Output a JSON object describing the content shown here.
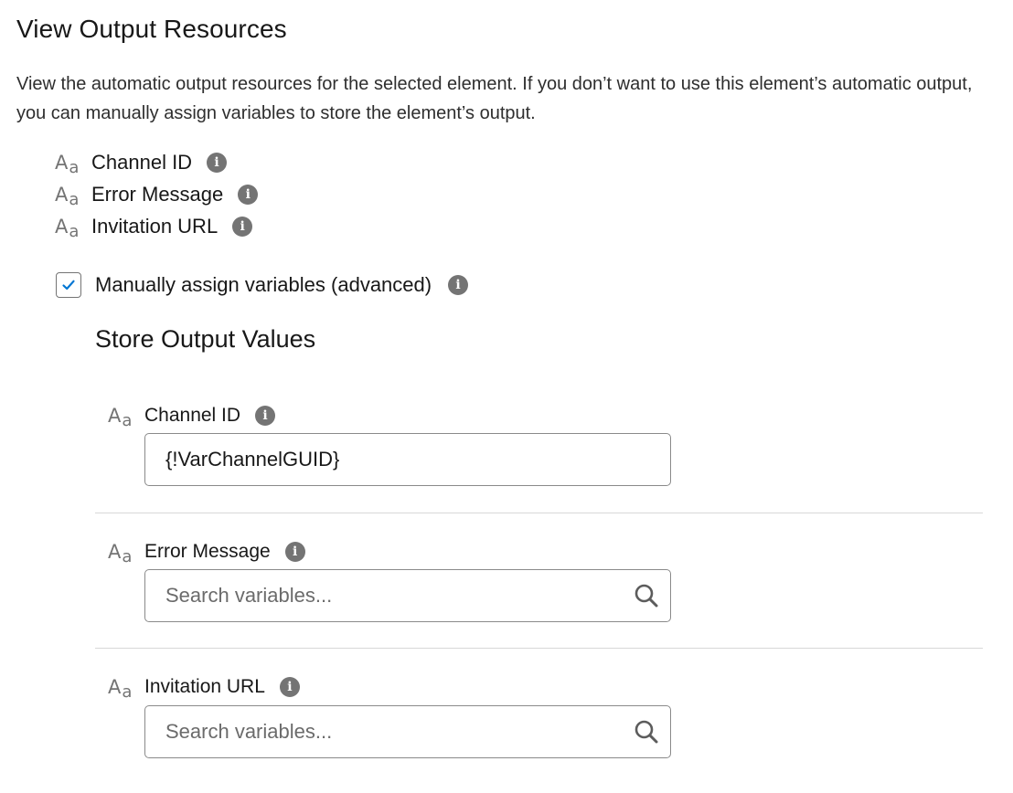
{
  "page": {
    "title": "View Output Resources",
    "description": "View the automatic output resources for the selected element. If you don’t want to use this element’s automatic output, you can manually assign variables to store the element’s output."
  },
  "resources": [
    {
      "icon": "text-type-icon",
      "glyph_big": "A",
      "glyph_small": "a",
      "label": "Channel ID",
      "info_glyph": "i"
    },
    {
      "icon": "text-type-icon",
      "glyph_big": "A",
      "glyph_small": "a",
      "label": "Error Message",
      "info_glyph": "i"
    },
    {
      "icon": "text-type-icon",
      "glyph_big": "A",
      "glyph_small": "a",
      "label": "Invitation URL",
      "info_glyph": "i"
    }
  ],
  "manual_assign": {
    "label": "Manually assign variables (advanced)",
    "checked": true,
    "info_glyph": "i"
  },
  "store_output": {
    "title": "Store Output Values",
    "fields": [
      {
        "label": "Channel ID",
        "value": "{!VarChannelGUID}",
        "placeholder": ""
      },
      {
        "label": "Error Message",
        "value": "",
        "placeholder": "Search variables..."
      },
      {
        "label": "Invitation URL",
        "value": "",
        "placeholder": "Search variables..."
      }
    ]
  },
  "colors": {
    "icon_gray": "#747474",
    "check_blue": "#0176d3",
    "text": "#181818"
  }
}
